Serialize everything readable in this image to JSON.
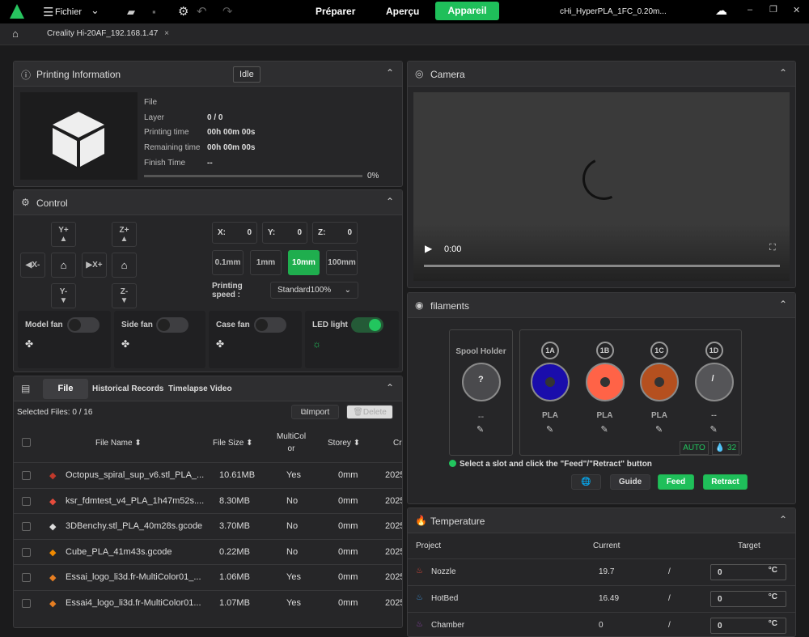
{
  "topbar": {
    "menu_label": "Fichier",
    "tabs": [
      "Préparer",
      "Aperçu",
      "Appareil"
    ],
    "active_tab": "Appareil",
    "file_title": "cHi_HyperPLA_1FC_0.20m...",
    "accent": "#1fbf5a"
  },
  "device_tab": {
    "label": "Creality Hi-20AF_192.168.1.47",
    "close": "×"
  },
  "printing": {
    "title": "Printing Information",
    "status": "Idle",
    "fields": [
      {
        "label": "File",
        "value": ""
      },
      {
        "label": "Layer",
        "value": "0 / 0"
      },
      {
        "label": "Printing time",
        "value": "00h 00m 00s"
      },
      {
        "label": "Remaining time",
        "value": "00h 00m 00s"
      },
      {
        "label": "Finish Time",
        "value": "--"
      }
    ],
    "progress_pct": 0,
    "progress_label": "0%"
  },
  "control": {
    "title": "Control",
    "jog": {
      "yplus": "Y+",
      "yminus": "Y-",
      "xminus": "X-",
      "xplus": "X+",
      "zplus": "Z+",
      "zminus": "Z-"
    },
    "coords": [
      {
        "label": "X:",
        "value": "0"
      },
      {
        "label": "Y:",
        "value": "0"
      },
      {
        "label": "Z:",
        "value": "0"
      }
    ],
    "steps": [
      "0.1mm",
      "1mm",
      "10mm",
      "100mm"
    ],
    "active_step": "10mm",
    "speed_label": "Printing speed :",
    "speed_value": "Standard100%",
    "fans": [
      {
        "label": "Model fan",
        "on": false
      },
      {
        "label": "Side fan",
        "on": false
      },
      {
        "label": "Case fan",
        "on": false
      },
      {
        "label": "LED light",
        "on": true
      }
    ]
  },
  "files": {
    "tabs": [
      "File",
      "Historical Records",
      "Timelapse Video"
    ],
    "active_tab": "File",
    "selected": "Selected Files: 0 / 16",
    "import": "Import",
    "delete": "Delete",
    "columns": [
      "File Name",
      "File Size",
      "MultiColor",
      "Storey",
      "Cr"
    ],
    "rows": [
      {
        "name": "Octopus_spiral_sup_v6.stl_PLA_...",
        "size": "10.61MB",
        "multi": "Yes",
        "storey": "0mm",
        "created": "2025",
        "icon_color": "#c0392b"
      },
      {
        "name": "ksr_fdmtest_v4_PLA_1h47m52s....",
        "size": "8.30MB",
        "multi": "No",
        "storey": "0mm",
        "created": "2025",
        "icon_color": "#e74c3c"
      },
      {
        "name": "3DBenchy.stl_PLA_40m28s.gcode",
        "size": "3.70MB",
        "multi": "No",
        "storey": "0mm",
        "created": "2025",
        "icon_color": "#dddddd"
      },
      {
        "name": "Cube_PLA_41m43s.gcode",
        "size": "0.22MB",
        "multi": "No",
        "storey": "0mm",
        "created": "2025",
        "icon_color": "#f08a00"
      },
      {
        "name": "Essai_logo_li3d.fr-MultiColor01_...",
        "size": "1.06MB",
        "multi": "Yes",
        "storey": "0mm",
        "created": "2025",
        "icon_color": "#e67e22"
      },
      {
        "name": "Essai4_logo_li3d.fr-MultiColor01...",
        "size": "1.07MB",
        "multi": "Yes",
        "storey": "0mm",
        "created": "2025",
        "icon_color": "#e67e22"
      }
    ]
  },
  "camera": {
    "title": "Camera",
    "time": "0:00"
  },
  "filaments": {
    "title": "filaments",
    "spool_holder": "Spool Holder",
    "spool_mark": "?",
    "spool_type": "--",
    "slots": [
      {
        "id": "1A",
        "type": "PLA",
        "color": "#1a0dab"
      },
      {
        "id": "1B",
        "type": "PLA",
        "color": "#ff6347"
      },
      {
        "id": "1C",
        "type": "PLA",
        "color": "#b5501f"
      },
      {
        "id": "1D",
        "type": "--",
        "color": "#555558"
      }
    ],
    "auto": "AUTO",
    "humidity": "32",
    "hint": "Select a slot and click the \"Feed\"/\"Retract\" button",
    "guide": "Guide",
    "feed": "Feed",
    "retract": "Retract"
  },
  "temperature": {
    "title": "Temperature",
    "columns": [
      "Project",
      "Current",
      "Target"
    ],
    "rows": [
      {
        "name": "Nozzle",
        "current": "19.7",
        "target": "0",
        "icon_color": "#e74c3c"
      },
      {
        "name": "HotBed",
        "current": "16.49",
        "target": "0",
        "icon_color": "#3b8fd6"
      },
      {
        "name": "Chamber",
        "current": "0",
        "target": "0",
        "icon_color": "#8e44ad"
      }
    ],
    "sep": "/",
    "unit": "°C"
  }
}
